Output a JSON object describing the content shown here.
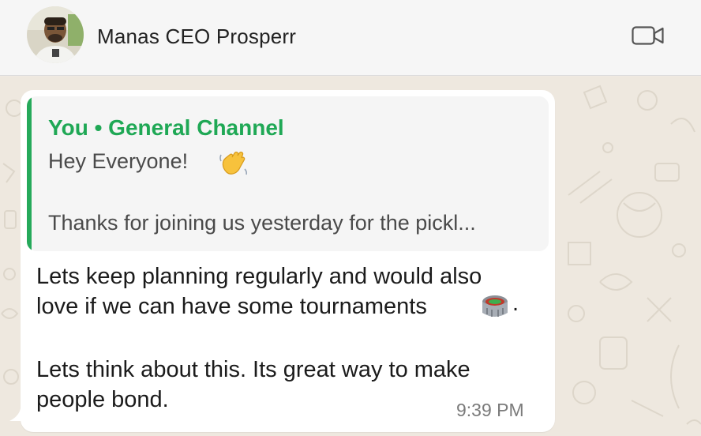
{
  "header": {
    "contact_name": "Manas CEO Prosperr",
    "avatar_icon": "profile-photo",
    "video_call_icon": "video-camera-icon"
  },
  "message": {
    "quoted": {
      "author": "You • General Channel",
      "line1": "Hey Everyone!",
      "line1_emoji": "waving-hand",
      "line2": "Thanks for joining us yesterday for the pickl..."
    },
    "body": {
      "line1": "Lets keep planning regularly and would also",
      "line2": "love if we can have some tournaments",
      "line2_emoji": "stadium",
      "line2_end": ".",
      "line3": "Lets think about this. Its great way to make",
      "line4": "people bond."
    },
    "timestamp": "9:39 PM"
  },
  "colors": {
    "accent_green": "#1fa855",
    "chat_background": "#eee8df",
    "bubble": "#ffffff",
    "quote_background": "#f5f5f5"
  }
}
